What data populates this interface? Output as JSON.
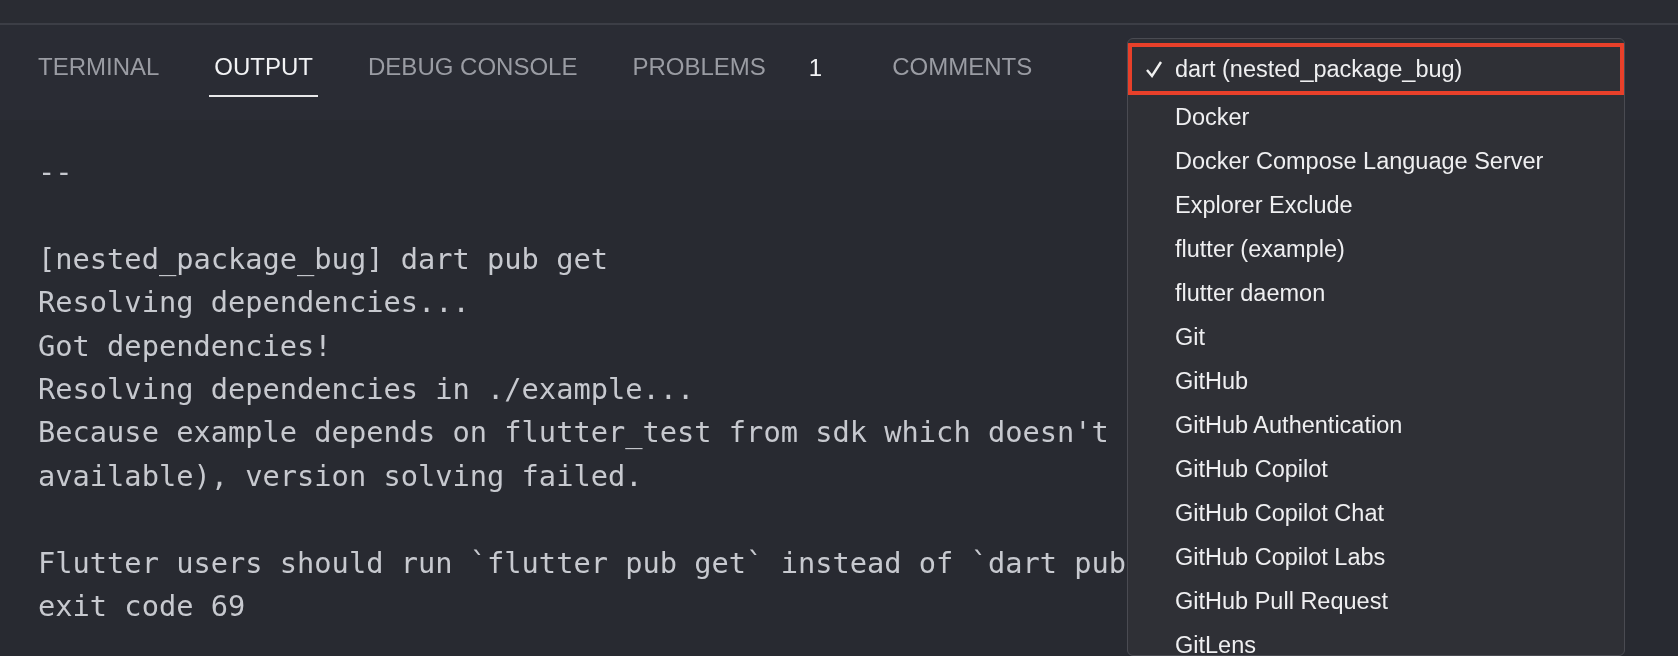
{
  "tabs": [
    {
      "label": "TERMINAL",
      "selected": false
    },
    {
      "label": "OUTPUT",
      "selected": true
    },
    {
      "label": "DEBUG CONSOLE",
      "selected": false
    },
    {
      "label": "PROBLEMS",
      "selected": false,
      "badge": "1"
    },
    {
      "label": "COMMENTS",
      "selected": false
    }
  ],
  "output_blocks": [
    [
      "--"
    ],
    [
      "[nested_package_bug] dart pub get",
      "Resolving dependencies...",
      "Got dependencies!",
      "Resolving dependencies in ./example...",
      "Because example depends on flutter_test from sdk which doesn't",
      "available), version solving failed."
    ],
    [
      "Flutter users should run `flutter pub get` instead of `dart pub",
      "exit code 69"
    ]
  ],
  "channel_menu": {
    "items": [
      {
        "label": "dart (nested_package_bug)",
        "selected": true,
        "annotated": true
      },
      {
        "label": "Docker",
        "selected": false,
        "annotated": false
      },
      {
        "label": "Docker Compose Language Server",
        "selected": false,
        "annotated": false
      },
      {
        "label": "Explorer Exclude",
        "selected": false,
        "annotated": false
      },
      {
        "label": "flutter (example)",
        "selected": false,
        "annotated": false
      },
      {
        "label": "flutter daemon",
        "selected": false,
        "annotated": false
      },
      {
        "label": "Git",
        "selected": false,
        "annotated": false
      },
      {
        "label": "GitHub",
        "selected": false,
        "annotated": false
      },
      {
        "label": "GitHub Authentication",
        "selected": false,
        "annotated": false
      },
      {
        "label": "GitHub Copilot",
        "selected": false,
        "annotated": false
      },
      {
        "label": "GitHub Copilot Chat",
        "selected": false,
        "annotated": false
      },
      {
        "label": "GitHub Copilot Labs",
        "selected": false,
        "annotated": false
      },
      {
        "label": "GitHub Pull Request",
        "selected": false,
        "annotated": false
      },
      {
        "label": "GitLens",
        "selected": false,
        "annotated": false
      }
    ]
  }
}
